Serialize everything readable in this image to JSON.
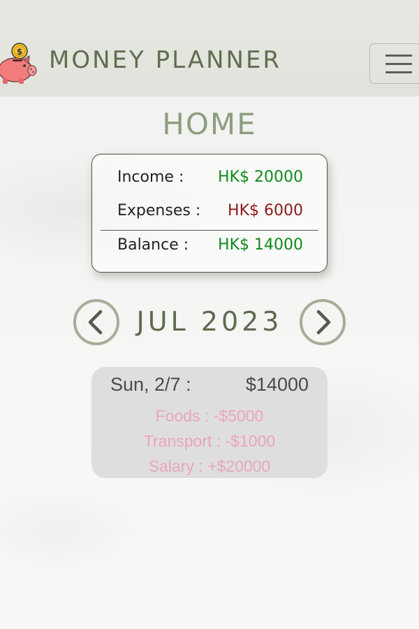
{
  "header": {
    "brand": "MONEY PLANNER",
    "logo_icon": "piggy-bank-icon",
    "menu_icon": "hamburger-menu-icon"
  },
  "page": {
    "title": "HOME"
  },
  "summary": {
    "income_label": "Income :",
    "income_value": "HK$ 20000",
    "expenses_label": "Expenses :",
    "expenses_value": "HK$ 6000",
    "balance_label": "Balance :",
    "balance_value": "HK$ 14000"
  },
  "month_nav": {
    "label": "JUL 2023",
    "prev_icon": "chevron-left-icon",
    "next_icon": "chevron-right-icon"
  },
  "days": [
    {
      "date": "Sun, 2/7 :",
      "total": "$14000",
      "entries": [
        {
          "text": "Foods : -$5000"
        },
        {
          "text": "Transport : -$1000"
        },
        {
          "text": "Salary : +$20000"
        }
      ]
    }
  ],
  "colors": {
    "navbar_bg": "#e4e5df",
    "brand_text": "#5f6e4f",
    "title_text": "#8d9e7e",
    "income_green": "#0f8a1a",
    "expense_red": "#8b1a1a",
    "entry_pink": "#eaa4c1",
    "day_card_bg": "#dedede"
  }
}
